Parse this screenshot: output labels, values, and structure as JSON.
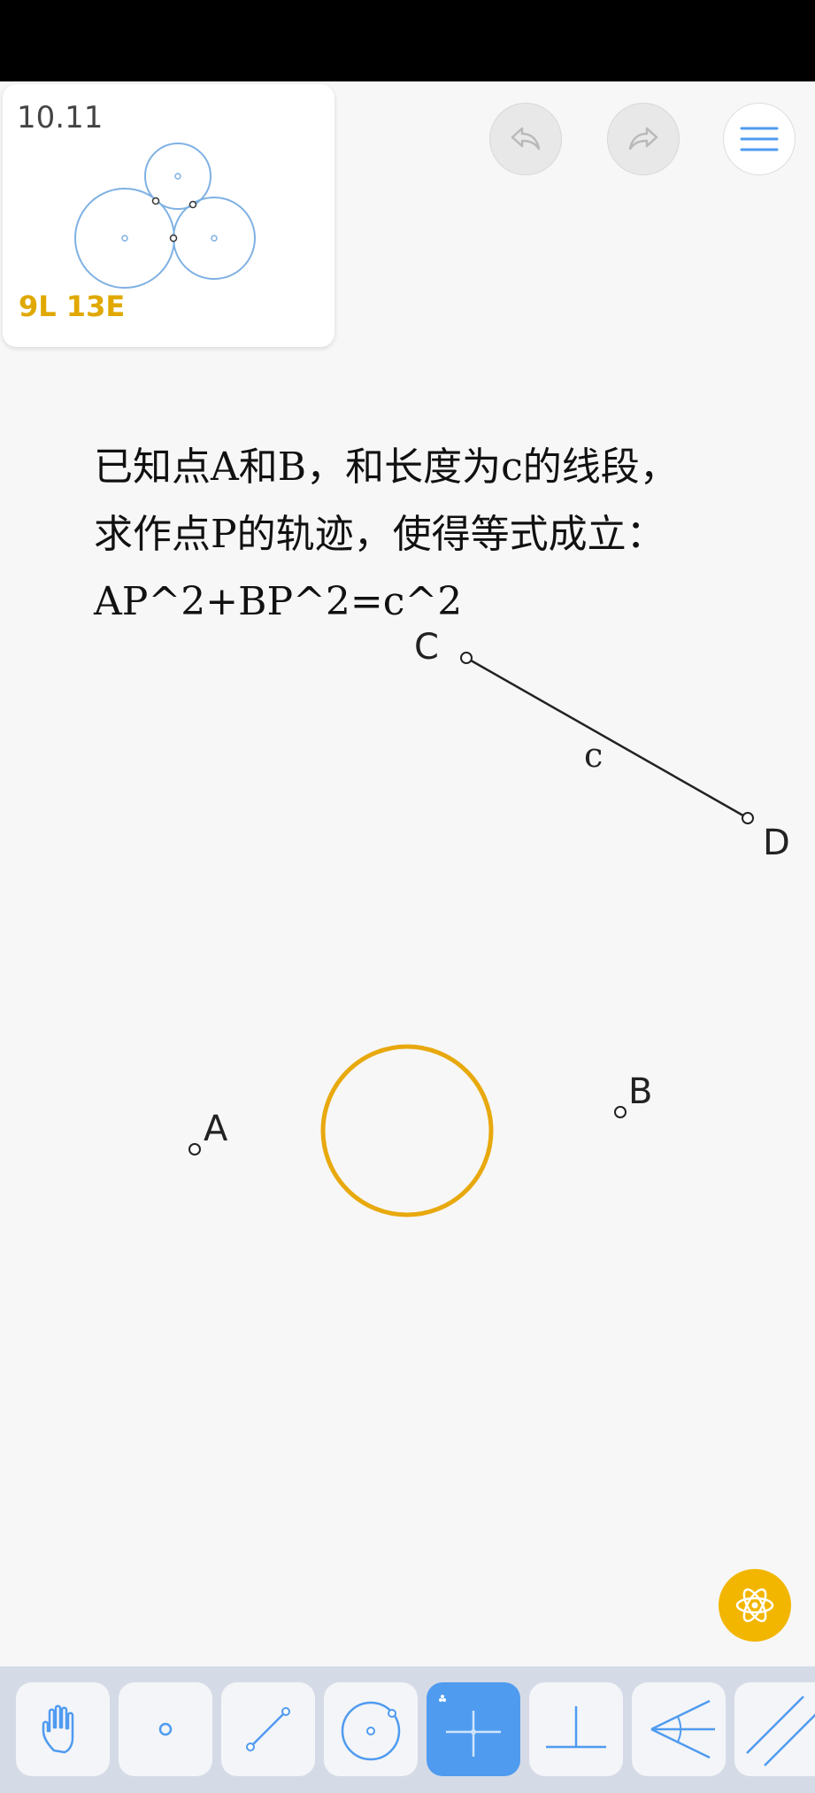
{
  "level": {
    "number": "10.11",
    "score": "9L 13E"
  },
  "problem": {
    "lines": [
      "已知点A和B，和长度为c的线段，",
      "求作点P的轨迹，使得等式成立：",
      "AP^2+BP^2=c^2"
    ]
  },
  "labels": {
    "C": "C",
    "D": "D",
    "c": "c",
    "A": "A",
    "B": "B"
  },
  "header": {
    "undo_icon": "undo-icon",
    "redo_icon": "redo-icon",
    "menu_icon": "menu-icon"
  },
  "toolbar": {
    "tools": [
      "hand-tool",
      "point-tool",
      "line-segment-tool",
      "circle-tool",
      "intersect-tool",
      "perpendicular-tool",
      "angle-bisector-tool",
      "parallel-tool"
    ],
    "active": "intersect-tool"
  },
  "colors": {
    "accent": "#4f9bf0",
    "goal_circle": "#e8a90e",
    "hint": "#f2b600",
    "level_score": "#e0a800",
    "thumbnail_circle": "#7fb1e3"
  }
}
